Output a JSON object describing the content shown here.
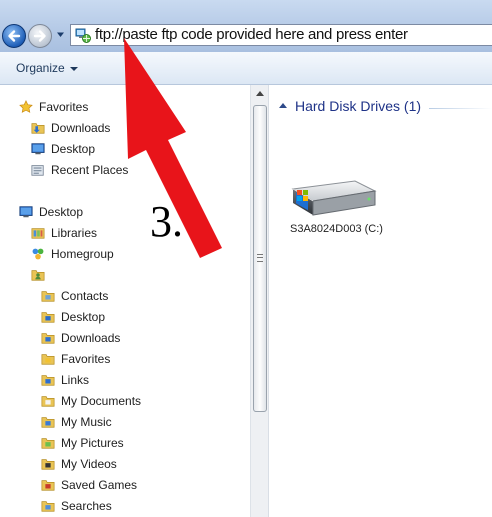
{
  "address_bar": {
    "value": "ftp://paste ftp code provided here and press enter"
  },
  "toolbar": {
    "organize_label": "Organize"
  },
  "nav": {
    "favorites": {
      "label": "Favorites",
      "items": [
        "Downloads",
        "Desktop",
        "Recent Places"
      ]
    },
    "desktop": {
      "label": "Desktop"
    },
    "desktop_children": [
      "Libraries",
      "Homegroup"
    ],
    "user_children": [
      "Contacts",
      "Desktop",
      "Downloads",
      "Favorites",
      "Links",
      "My Documents",
      "My Music",
      "My Pictures",
      "My Videos",
      "Saved Games",
      "Searches"
    ]
  },
  "content": {
    "group_header": "Hard Disk Drives (1)",
    "drive_label": "S3A8024D003 (C:)"
  },
  "annotation": {
    "step": "3."
  },
  "colors": {
    "accent": "#1e3287",
    "arrow": "#e8141a"
  }
}
